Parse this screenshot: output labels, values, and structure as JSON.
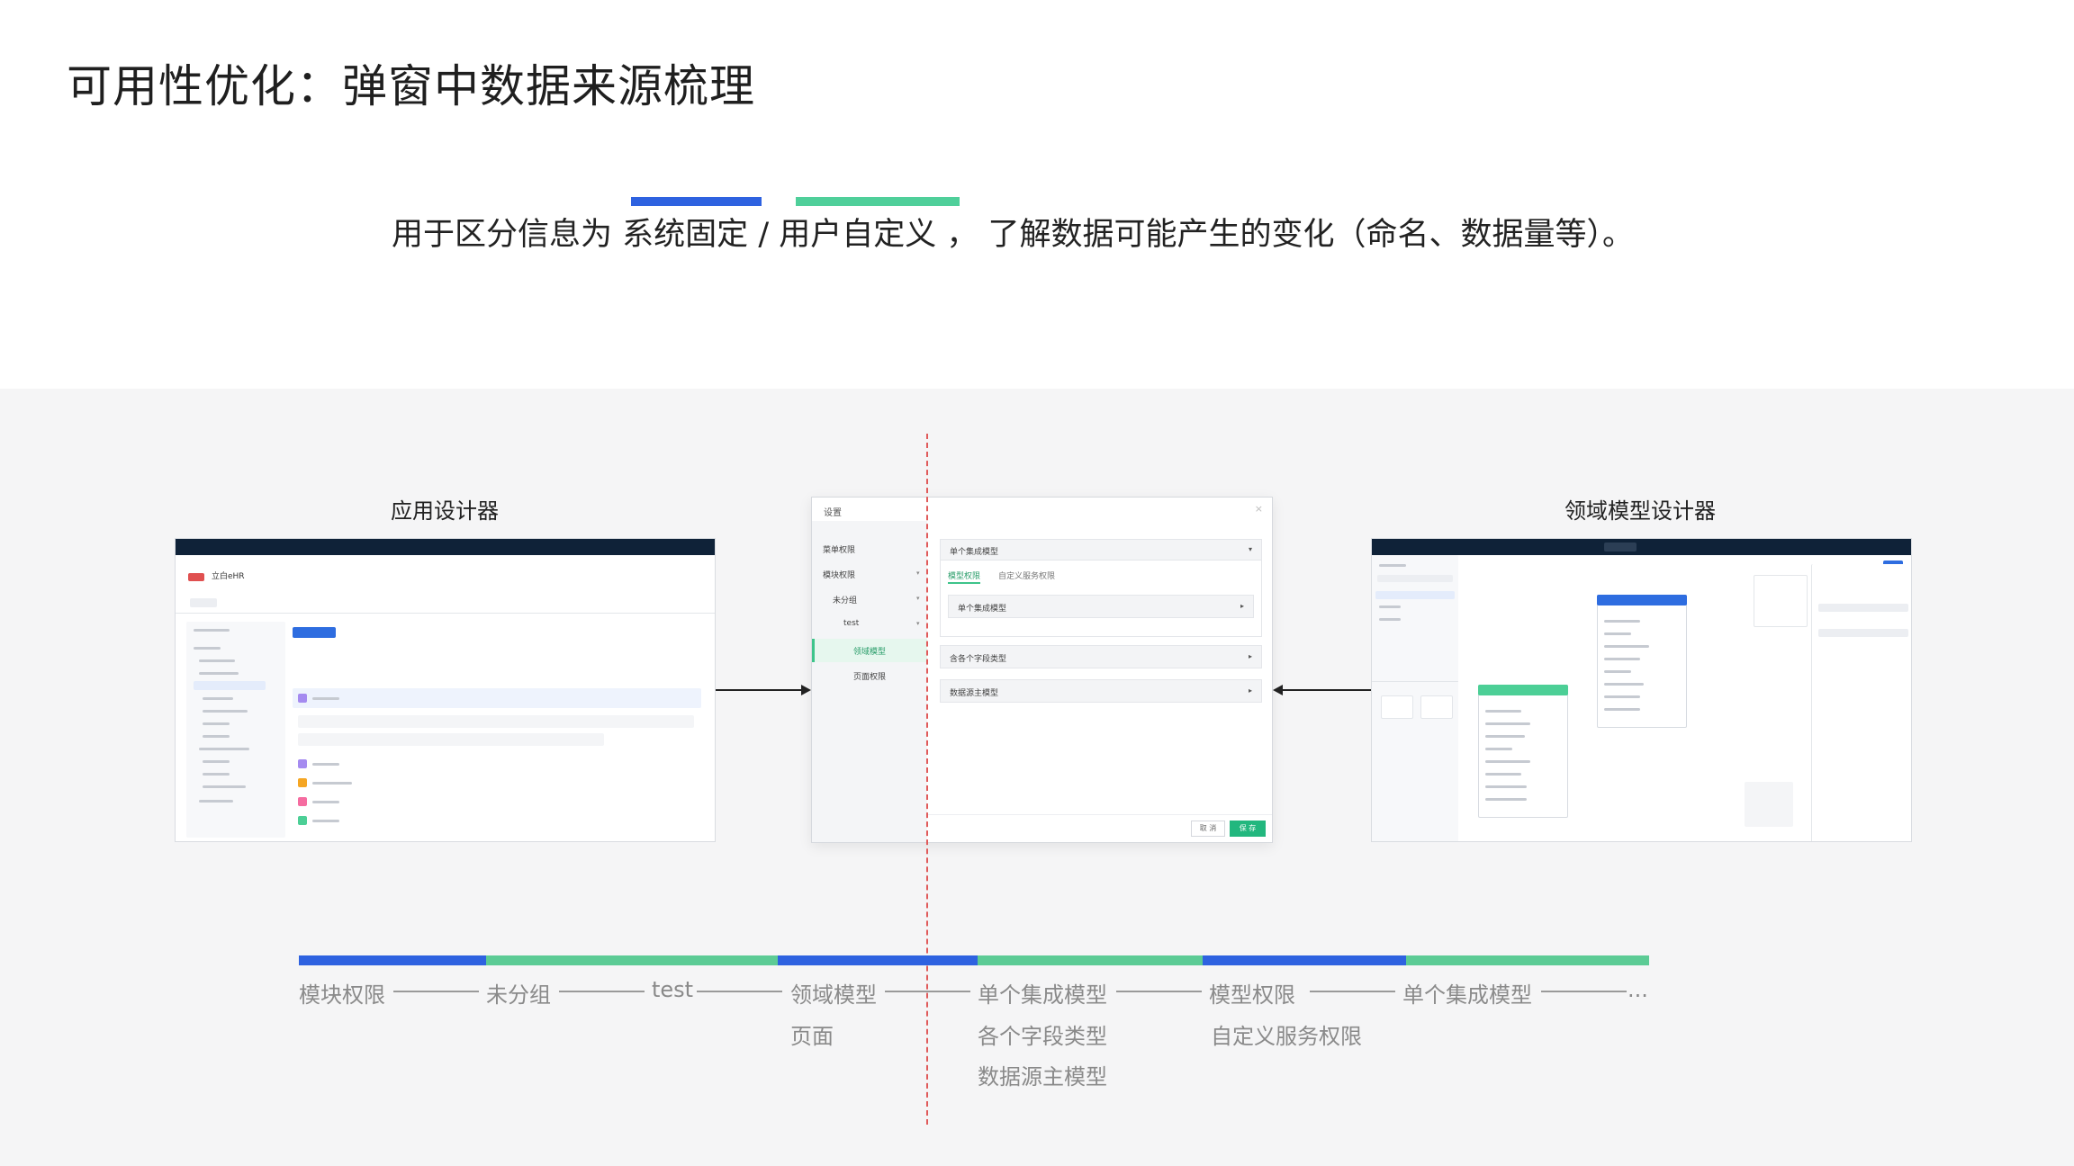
{
  "page": {
    "title": "可用性优化：弹窗中数据来源梳理"
  },
  "subtitle": {
    "prefix": "用于区分信息为",
    "system": "系统固定",
    "separator": "/",
    "user": "用户自定义",
    "suffix": "，  了解数据可能产生的变化（命名、数据量等）。",
    "colors": {
      "system": "#2e62e0",
      "user": "#4fcf9a"
    }
  },
  "panels": {
    "left_label": "应用设计器",
    "right_label": "领域模型设计器"
  },
  "left_shot": {
    "app_name": "立白eHR",
    "create_button": "+ 创建模块"
  },
  "dialog": {
    "title": "设置",
    "close": "×",
    "sidebar": [
      {
        "label": "菜单权限"
      },
      {
        "label": "模块权限"
      },
      {
        "label": "未分组"
      },
      {
        "label": "test"
      },
      {
        "label": "领域模型"
      },
      {
        "label": "页面权限"
      }
    ],
    "accordions": {
      "single_model": "单个集成模型",
      "tab_model": "模型权限",
      "tab_custom": "自定义服务权限",
      "inner_single": "单个集成模型",
      "fields": "含各个字段类型",
      "datasource": "数据源主模型"
    },
    "cancel": "取 消",
    "save": "保 存"
  },
  "timeline": {
    "colors": {
      "blue": "#2e62e0",
      "green": "#5ccb95"
    },
    "steps": {
      "module": "模块权限",
      "ungrouped": "未分组",
      "test": "test",
      "domain": "领域模型",
      "page": "页面",
      "single": "单个集成模型",
      "fields": "各个字段类型",
      "datasource": "数据源主模型",
      "model_perm": "模型权限",
      "custom_perm": "自定义服务权限",
      "single2": "单个集成模型",
      "ellipsis": "..."
    }
  }
}
